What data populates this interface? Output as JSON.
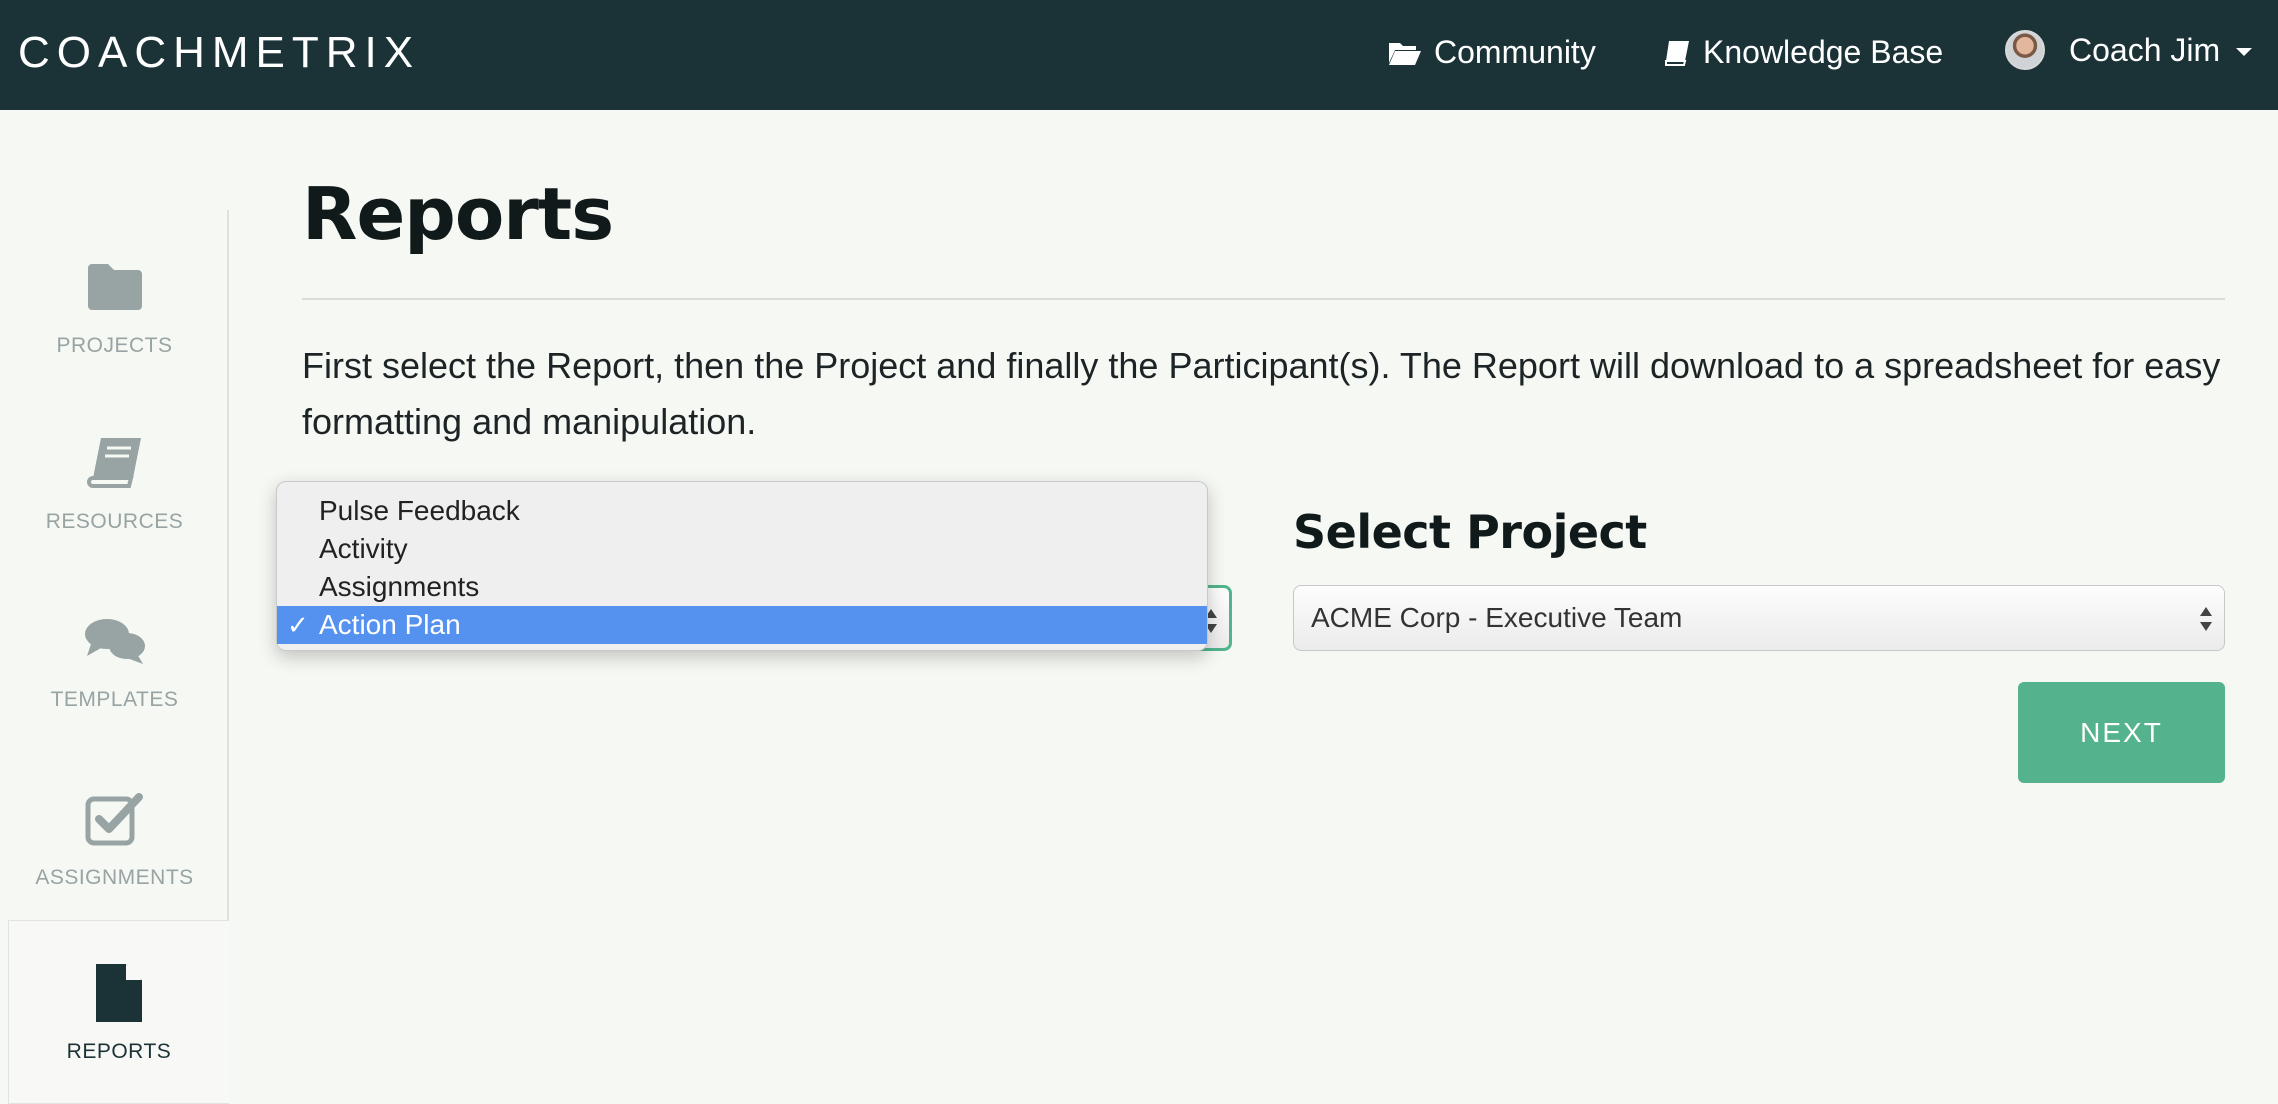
{
  "navbar": {
    "logo": "COACHMETRIX",
    "community": "Community",
    "knowledge_base": "Knowledge Base",
    "user_name": "Coach Jim"
  },
  "sidebar": {
    "items": [
      {
        "label": "PROJECTS",
        "icon": "folder-icon"
      },
      {
        "label": "RESOURCES",
        "icon": "book-icon"
      },
      {
        "label": "TEMPLATES",
        "icon": "chat-bubbles-icon"
      },
      {
        "label": "ASSIGNMENTS",
        "icon": "checkbox-icon"
      },
      {
        "label": "REPORTS",
        "icon": "document-icon",
        "active": true
      }
    ]
  },
  "main": {
    "title": "Reports",
    "intro": "First select the Report, then the Project and finally the Participant(s). The Report will download to a spreadsheet for easy formatting and manipulation.",
    "select_project_label": "Select Project",
    "project_value": "ACME Corp - Executive Team",
    "next_label": "NEXT"
  },
  "report_dropdown": {
    "options": [
      "Pulse Feedback",
      "Activity",
      "Assignments",
      "Action Plan"
    ],
    "selected": "Action Plan",
    "check_mark": "✓"
  },
  "colors": {
    "navbar": "#1b3337",
    "accent": "#54b38d",
    "selection": "#5591ef",
    "background": "#f6f8f4"
  }
}
